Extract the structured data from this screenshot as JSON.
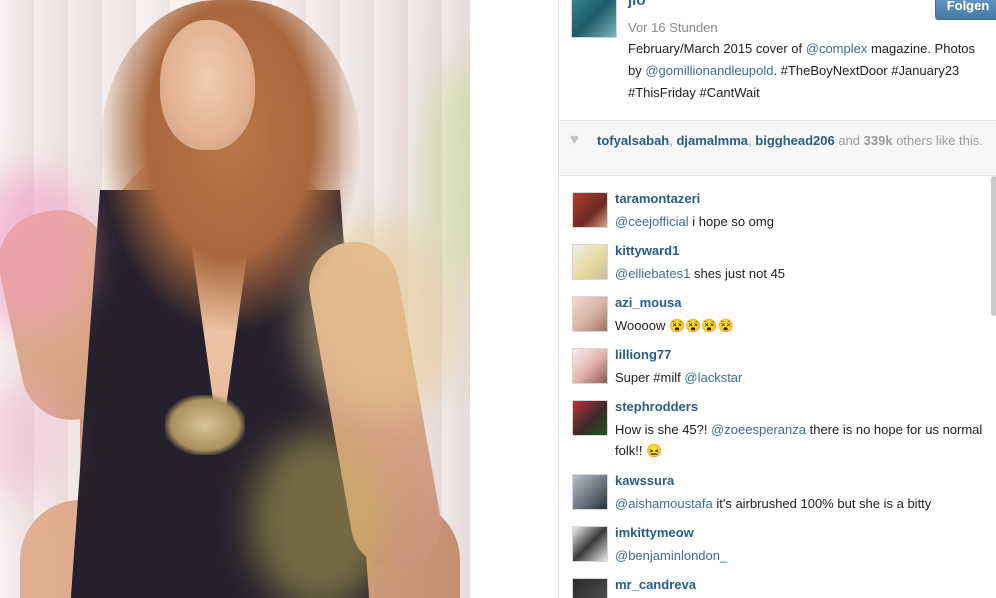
{
  "post": {
    "username": "jlo",
    "follow_label": "Folgen",
    "timestamp": "Vor 16 Stunden",
    "caption": {
      "part1": "February/March 2015 cover of ",
      "mention1": "@complex",
      "part2": " magazine. Photos by ",
      "mention2": "@gomillionandleupold",
      "part3": ". #TheBoyNextDoor #January23 #ThisFriday #CantWait"
    }
  },
  "likes": {
    "user1": "tofyalsabah",
    "sep1": ", ",
    "user2": "djamalmma",
    "sep2": ", ",
    "user3": "bigghead206",
    "and": " and ",
    "count": "339k",
    "rest": " others like this."
  },
  "comments": [
    {
      "user": "taramontazeri",
      "mention": "@ceejofficial",
      "text": " i hope so omg"
    },
    {
      "user": "kittyward1",
      "mention": "@elliebates1",
      "text": " shes just not 45"
    },
    {
      "user": "azi_mousa",
      "mention": "",
      "text": "Woooow 😵😵😵😵"
    },
    {
      "user": "lilliong77",
      "mention": "",
      "text": "Super #milf ",
      "mention_after": "@lackstar"
    },
    {
      "user": "stephrodders",
      "pre": "How is she 45?! ",
      "mention": "@zoeesperanza",
      "text": " there is no hope for us normal folk!! 😖"
    },
    {
      "user": "kawssura",
      "mention": "@aishamoustafa",
      "text": " it's airbrushed 100% but she is a bitty"
    },
    {
      "user": "imkittymeow",
      "mention": "@benjaminlondon_",
      "text": ""
    },
    {
      "user": "mr_candreva",
      "mention": "",
      "text": ""
    }
  ],
  "icons": {
    "heart": "heart-icon"
  }
}
